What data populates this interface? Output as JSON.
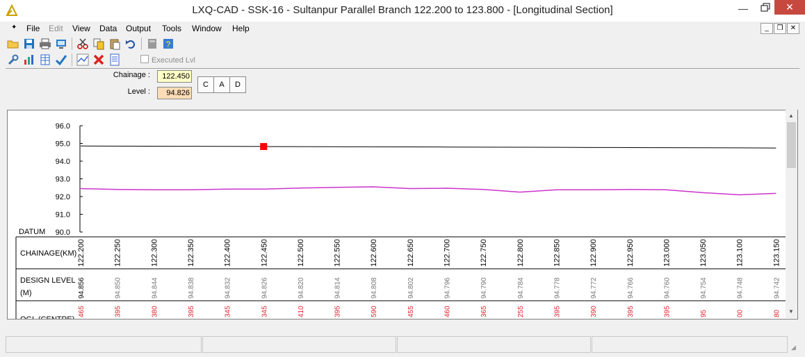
{
  "window": {
    "title": "LXQ-CAD - SSK-16 - Sultanpur Parallel Branch 122.200 to 123.800 - [Longitudinal Section]"
  },
  "menu": [
    "File",
    "Edit",
    "View",
    "Data",
    "Output",
    "Tools",
    "Window",
    "Help"
  ],
  "toolbar": {
    "executed_label": "Executed Lvl"
  },
  "controls": {
    "chainage_label": "Chainage :",
    "chainage_value": "122.450",
    "level_label": "Level :",
    "level_value": "94.826",
    "buttons": [
      "C",
      "A",
      "D"
    ]
  },
  "colors": {
    "design_line": "#000000",
    "ogl_line": "#cc33cc",
    "marker": "#ff0000",
    "ogl_text": "#e0242f",
    "design_text": "#777777"
  },
  "chart_data": {
    "type": "line",
    "ylim": [
      90.0,
      96.0
    ],
    "y_ticks": [
      "96.0",
      "95.0",
      "94.0",
      "93.0",
      "92.0",
      "91.0",
      "90.0"
    ],
    "datum_label": "DATUM",
    "band_labels": {
      "chainage": "CHAINAGE(KM)",
      "design": "DESIGN LEVEL",
      "design_unit": "(M)",
      "ogl": "OGL (CENTRE)"
    },
    "chainages": [
      "122.200",
      "122.250",
      "122.300",
      "122.350",
      "122.400",
      "122.450",
      "122.500",
      "122.550",
      "122.600",
      "122.650",
      "122.700",
      "122.750",
      "122.800",
      "122.850",
      "122.900",
      "122.950",
      "123.000",
      "123.050",
      "123.100",
      "123.150"
    ],
    "design_levels": [
      "94.856",
      "94.850",
      "94.844",
      "94.838",
      "94.832",
      "94.826",
      "94.820",
      "94.814",
      "94.808",
      "94.802",
      "94.796",
      "94.790",
      "94.784",
      "94.778",
      "94.772",
      "94.766",
      "94.760",
      "94.754",
      "94.748",
      "94.742"
    ],
    "ogl_fragments": [
      "465",
      "395",
      "380",
      "395",
      "345",
      "345",
      "410",
      "395",
      "590",
      "455",
      "460",
      "365",
      "255",
      "395",
      "390",
      "395",
      "395",
      "95",
      "00",
      "80"
    ],
    "ogl_levels": [
      92.45,
      92.4,
      92.38,
      92.38,
      92.42,
      92.42,
      92.48,
      92.52,
      92.55,
      92.45,
      92.47,
      92.4,
      92.25,
      92.38,
      92.38,
      92.4,
      92.38,
      92.22,
      92.1,
      92.18
    ],
    "marker_chainage": "122.450",
    "marker_level": 94.826
  },
  "statusbar": {
    "panes": [
      "",
      "",
      "",
      ""
    ]
  }
}
